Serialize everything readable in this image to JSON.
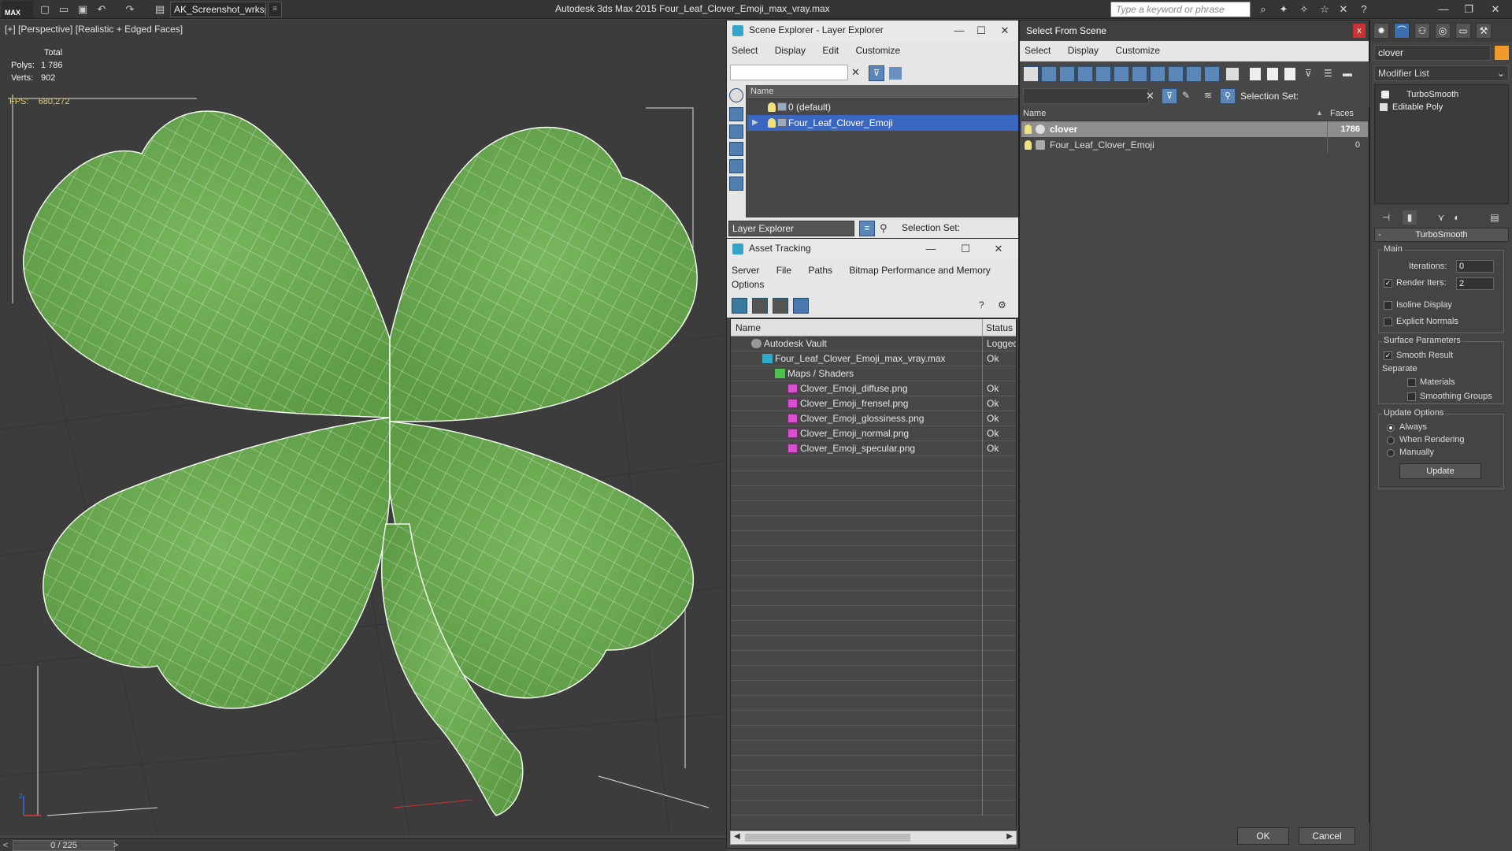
{
  "app": {
    "logo": "MAX",
    "title": "Autodesk 3ds Max  2015     Four_Leaf_Clover_Emoji_max_vray.max",
    "workspace": "AK_Screenshot_wrksp",
    "search_placeholder": "Type a keyword or phrase",
    "icons": [
      "new-icon",
      "open-icon",
      "save-icon",
      "undo-icon",
      "redo-icon",
      "project-icon"
    ]
  },
  "viewport": {
    "label": "[+] [Perspective] [Realistic + Edged Faces]",
    "stats_title": "Total",
    "polys_label": "Polys:",
    "polys_value": "1 786",
    "verts_label": "Verts:",
    "verts_value": "902",
    "fps_label": "FPS:",
    "fps_value": "680,272",
    "axis_z": "z",
    "mesh_color": "#6fae55"
  },
  "timeslider": {
    "frame": "0 / 225",
    "prev": "<",
    "next": ">"
  },
  "scene_explorer": {
    "title": "Scene Explorer - Layer Explorer",
    "menu": [
      "Select",
      "Display",
      "Edit",
      "Customize"
    ],
    "column_name": "Name",
    "rows": [
      {
        "label": "0 (default)",
        "selected": false
      },
      {
        "label": "Four_Leaf_Clover_Emoji",
        "selected": true
      }
    ],
    "footer_dropdown": "Layer Explorer",
    "selection_set_label": "Selection Set:"
  },
  "asset_tracking": {
    "title": "Asset Tracking",
    "menu": [
      "Server",
      "File",
      "Paths",
      "Bitmap Performance and Memory"
    ],
    "menu2": "Options",
    "col_name": "Name",
    "col_status": "Status",
    "rows": [
      {
        "name": "Autodesk Vault",
        "status": "Logged",
        "indent": 1,
        "icon": "vault"
      },
      {
        "name": "Four_Leaf_Clover_Emoji_max_vray.max",
        "status": "Ok",
        "indent": 2,
        "icon": "max"
      },
      {
        "name": "Maps / Shaders",
        "status": "",
        "indent": 3,
        "icon": "folder"
      },
      {
        "name": "Clover_Emoji_diffuse.png",
        "status": "Ok",
        "indent": 4,
        "icon": "png"
      },
      {
        "name": "Clover_Emoji_frensel.png",
        "status": "Ok",
        "indent": 4,
        "icon": "png"
      },
      {
        "name": "Clover_Emoji_glossiness.png",
        "status": "Ok",
        "indent": 4,
        "icon": "png"
      },
      {
        "name": "Clover_Emoji_normal.png",
        "status": "Ok",
        "indent": 4,
        "icon": "png"
      },
      {
        "name": "Clover_Emoji_specular.png",
        "status": "Ok",
        "indent": 4,
        "icon": "png"
      }
    ]
  },
  "select_from_scene": {
    "title": "Select From Scene",
    "menu": [
      "Select",
      "Display",
      "Customize"
    ],
    "selection_set_label": "Selection Set:",
    "col_name": "Name",
    "col_faces": "Faces",
    "rows": [
      {
        "name": "clover",
        "faces": "1786",
        "selected": true
      },
      {
        "name": "Four_Leaf_Clover_Emoji",
        "faces": "0",
        "selected": false
      }
    ],
    "ok": "OK",
    "cancel": "Cancel"
  },
  "command_panel": {
    "object_name": "clover",
    "object_color": "#f09a2a",
    "modifier_list": "Modifier List",
    "stack": [
      "TurboSmooth",
      "Editable Poly"
    ],
    "rollout_title": "TurboSmooth",
    "main_group": "Main",
    "iterations_label": "Iterations:",
    "iterations_value": "0",
    "render_iters_label": "Render Iters:",
    "render_iters_value": "2",
    "render_iters_checked": true,
    "isoline_label": "Isoline Display",
    "explicit_normals_label": "Explicit Normals",
    "surface_group": "Surface Parameters",
    "smooth_result_label": "Smooth Result",
    "separate_label": "Separate",
    "materials_label": "Materials",
    "smoothing_groups_label": "Smoothing Groups",
    "update_group": "Update Options",
    "update_always": "Always",
    "update_rendering": "When Rendering",
    "update_manually": "Manually",
    "update_button": "Update"
  }
}
